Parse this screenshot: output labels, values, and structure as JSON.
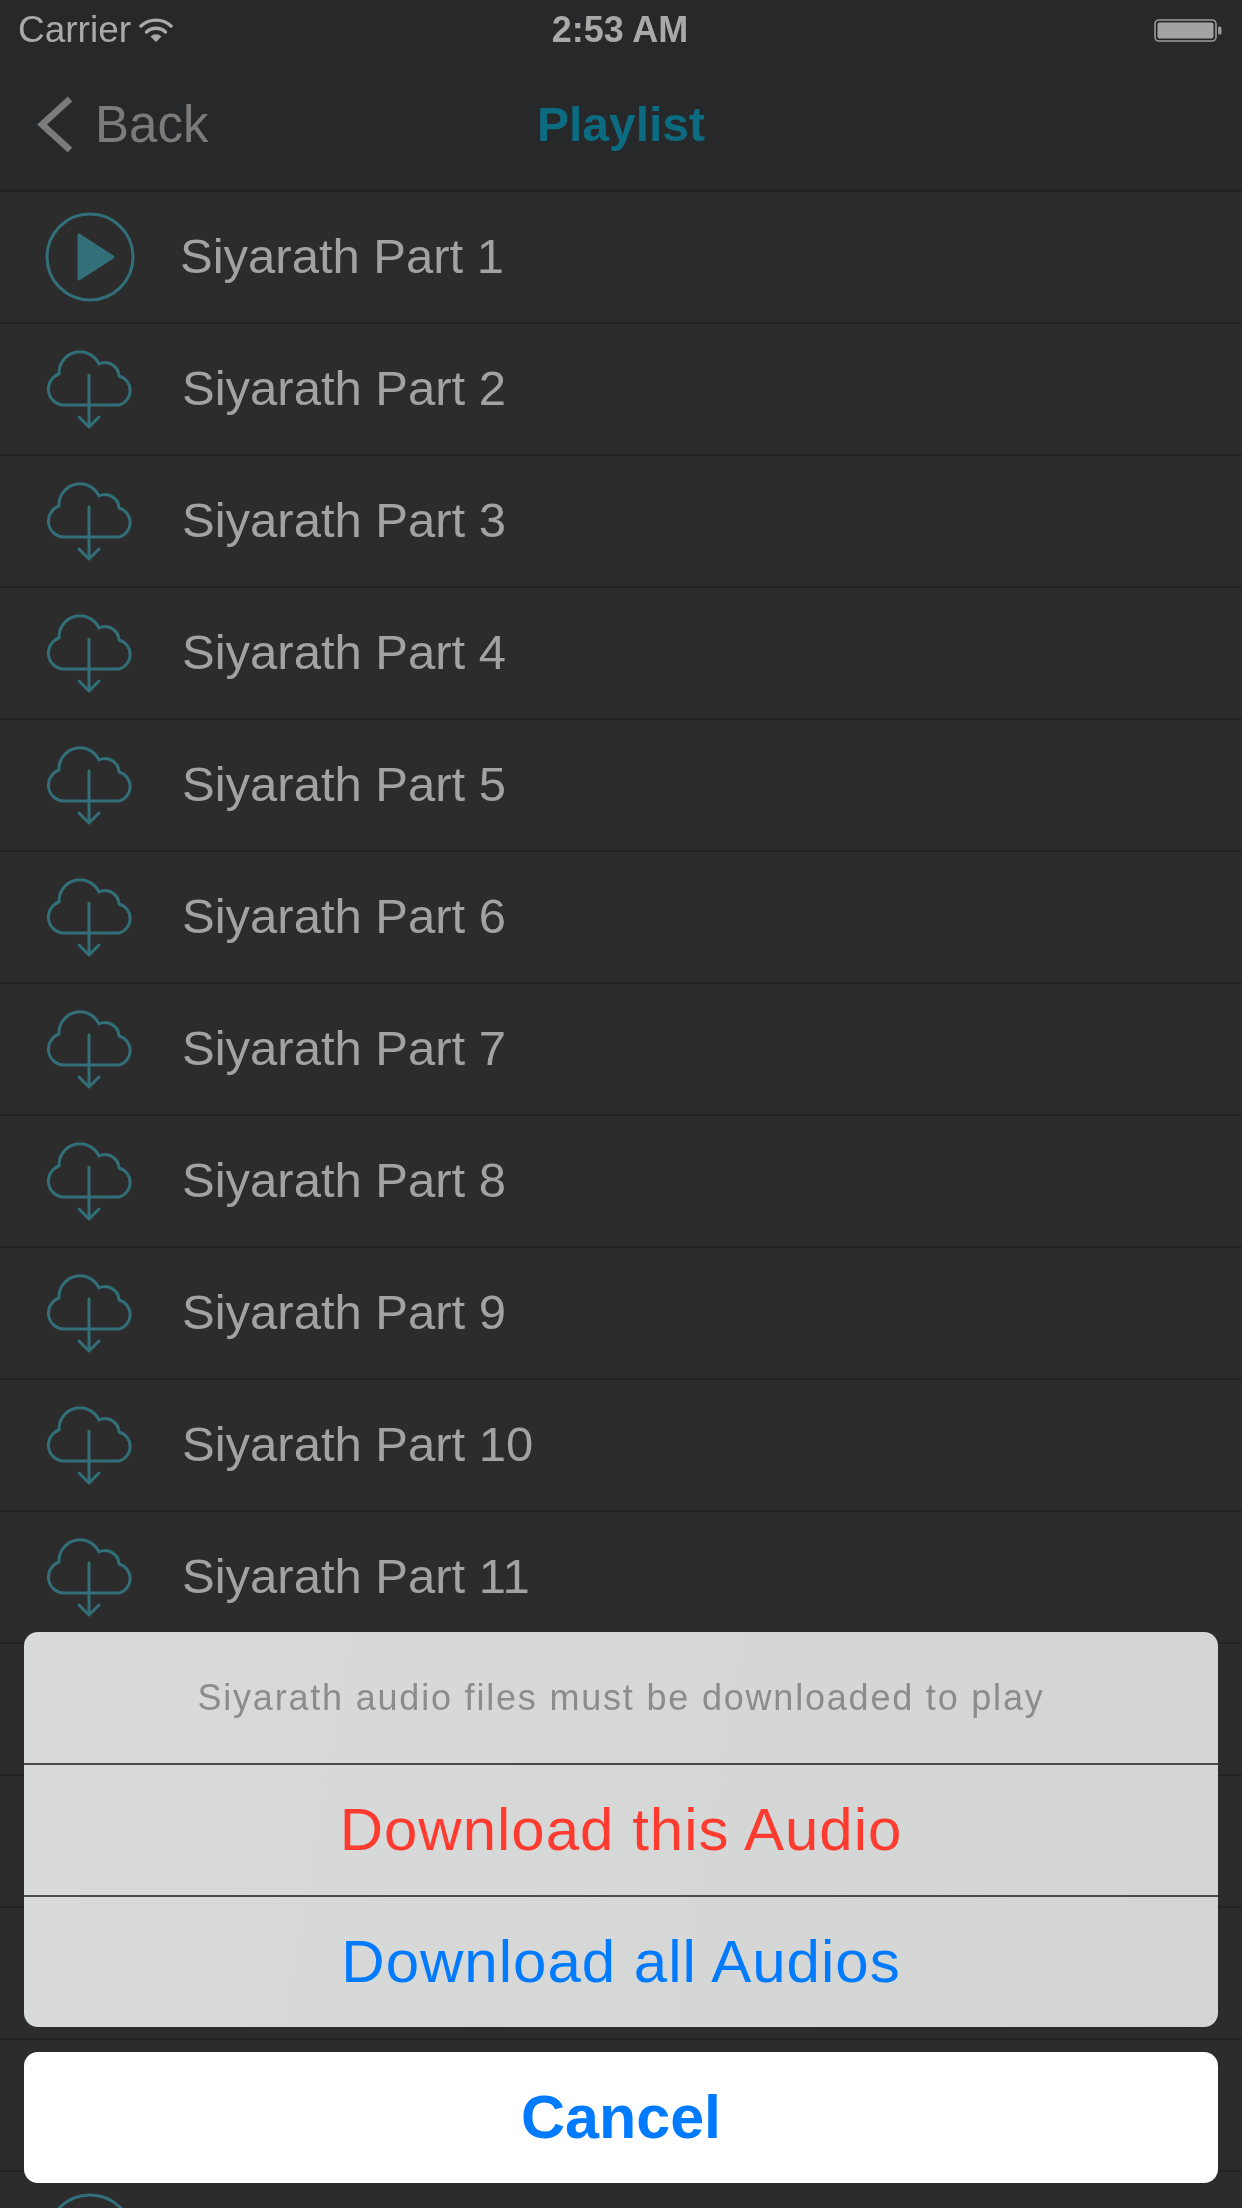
{
  "status_bar": {
    "carrier": "Carrier",
    "time": "2:53 AM"
  },
  "nav_bar": {
    "back": "Back",
    "title": "Playlist"
  },
  "playlist": [
    {
      "title": "Siyarath Part 1",
      "kind": "play"
    },
    {
      "title": "Siyarath Part 2",
      "kind": "download"
    },
    {
      "title": "Siyarath Part 3",
      "kind": "download"
    },
    {
      "title": "Siyarath Part 4",
      "kind": "download"
    },
    {
      "title": "Siyarath Part 5",
      "kind": "download"
    },
    {
      "title": "Siyarath Part 6",
      "kind": "download"
    },
    {
      "title": "Siyarath Part 7",
      "kind": "download"
    },
    {
      "title": "Siyarath Part 8",
      "kind": "download"
    },
    {
      "title": "Siyarath Part 9",
      "kind": "download"
    },
    {
      "title": "Siyarath Part 10",
      "kind": "download"
    },
    {
      "title": "Siyarath Part 11",
      "kind": "download"
    }
  ],
  "cut_off_row": {
    "kind": "play"
  },
  "action_sheet": {
    "message": "Siyarath audio files must be downloaded to play",
    "actions": [
      {
        "label": "Download this Audio",
        "kind": "destructive"
      },
      {
        "label": "Download all Audios",
        "kind": "normal"
      }
    ],
    "cancel": "Cancel"
  }
}
